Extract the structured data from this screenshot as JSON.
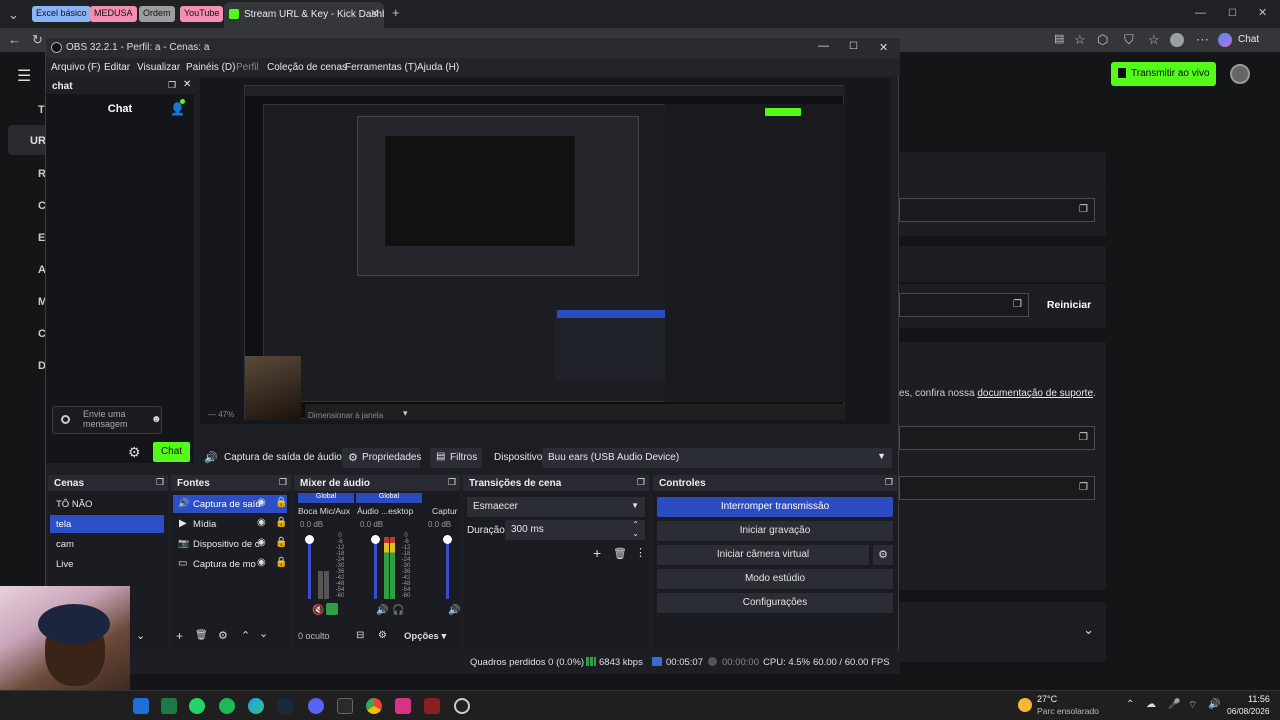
{
  "browser": {
    "bookmarks": [
      "Excel básico",
      "MEDUSA",
      "Ordem",
      "YouTube"
    ],
    "bookmark_colors": [
      "#8ab4f8",
      "#f48fb1",
      "#9e9e9e",
      "#f48fb1"
    ],
    "active_tab": "Stream URL & Key - Kick Dashboa",
    "chat_label": "Chat"
  },
  "kick": {
    "go_live": "Transmitir ao vivo",
    "restart": "Reiniciar",
    "support_prefix": "es, confira nossa ",
    "support_link": "documentação de suporte",
    "support_suffix": ".",
    "sidebar_letters": [
      "T",
      "UR",
      "R",
      "C",
      "E",
      "A",
      "M",
      "C",
      "D"
    ]
  },
  "obs": {
    "title": "OBS 32.2.1 - Perfil: a - Cenas: a",
    "menu": [
      "Arquivo (F)",
      "Editar",
      "Visualizar",
      "Painéis (D)",
      "Perfil",
      "Coleção de cenas",
      "Ferramentas (T)",
      "Ajuda (H)"
    ],
    "chat": {
      "dock_title": "chat",
      "header": "Chat",
      "placeholder": "Envie uma mensagem",
      "send": "Chat"
    },
    "preview": {
      "zoom": "47%",
      "scale_label": "Dimensionar à janela"
    },
    "source_bar": {
      "source": "Captura de saída de áudio :",
      "properties": "Propriedades",
      "filters": "Filtros",
      "device_label": "Dispositivo",
      "device_value": "Buu ears (USB Audio Device)"
    },
    "scenes": {
      "title": "Cenas",
      "items": [
        "TÔ NÃO",
        "tela",
        "cam",
        "Live"
      ],
      "selected": 1
    },
    "sources": {
      "title": "Fontes",
      "items": [
        "Captura de saíd",
        "Mídia",
        "Dispositivo de c",
        "Captura de mo"
      ]
    },
    "mixer": {
      "title": "Mixer de áudio",
      "global": "Global",
      "channels": [
        {
          "name": "Boca Mic/Aux",
          "db": "0.0 dB"
        },
        {
          "name": "Áudio ...esktop",
          "db": "0.0 dB"
        },
        {
          "name": "Captur",
          "db": "0.0 dB"
        }
      ],
      "scale": [
        "0",
        "-6",
        "-12",
        "-18",
        "-24",
        "-30",
        "-36",
        "-42",
        "-48",
        "-54",
        "-60"
      ],
      "hidden": "0 oculto",
      "options": "Opções"
    },
    "transitions": {
      "title": "Transições de cena",
      "type": "Esmaecer",
      "duration_label": "Duração",
      "duration": "300 ms"
    },
    "controls": {
      "title": "Controles",
      "stop_stream": "Interromper transmissão",
      "start_recording": "Iniciar gravação",
      "virtual_cam": "Iniciar câmera virtual",
      "studio": "Modo estúdio",
      "settings": "Configurações"
    },
    "status": {
      "dropped": "Quadros perdidos 0 (0.0%)",
      "bitrate": "6843 kbps",
      "stream_time": "00:05:07",
      "rec_time": "00:00:00",
      "cpu": "CPU: 4.5%",
      "fps": "60.00 / 60.00 FPS"
    }
  },
  "taskbar": {
    "weather_temp": "27°C",
    "weather_desc": "Parc ensolarado",
    "time": "11:56",
    "date": "06/08/2026"
  }
}
